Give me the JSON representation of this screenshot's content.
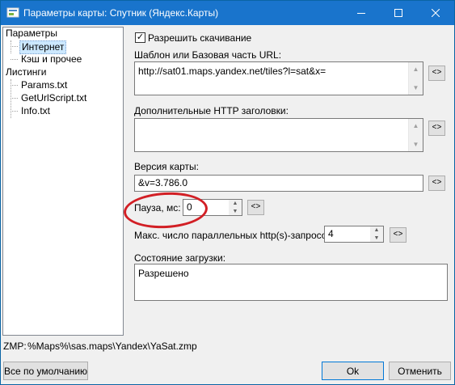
{
  "window": {
    "title": "Параметры карты: Спутник (Яндекс.Карты)"
  },
  "tree": {
    "root1": "Параметры",
    "internet": "Интернет",
    "cache": "Кэш и прочее",
    "root2": "Листинги",
    "params": "Params.txt",
    "geturl": "GetUrlScript.txt",
    "info": "Info.txt"
  },
  "form": {
    "allow_download": {
      "label": "Разрешить скачивание",
      "checked": true,
      "mark": "✓"
    },
    "url_label": "Шаблон или Базовая часть URL:",
    "url_value": "http://sat01.maps.yandex.net/tiles?l=sat&x=",
    "headers_label": "Дополнительные HTTP заголовки:",
    "headers_value": "",
    "version_label": "Версия карты:",
    "version_value": "&v=3.786.0",
    "pause_label": "Пауза, мс:",
    "pause_value": "0",
    "maxreq_label": "Макс. число параллельных http(s)-запросов:",
    "maxreq_value": "4",
    "status_label": "Состояние загрузки:",
    "status_value": "Разрешено",
    "reset_symbol": "<>"
  },
  "footer": {
    "zmp_label": "ZMP:",
    "zmp_path": "%Maps%\\sas.maps\\Yandex\\YaSat.zmp",
    "defaults_button": "Все по умолчанию",
    "ok_button": "Ok",
    "cancel_button": "Отменить"
  }
}
